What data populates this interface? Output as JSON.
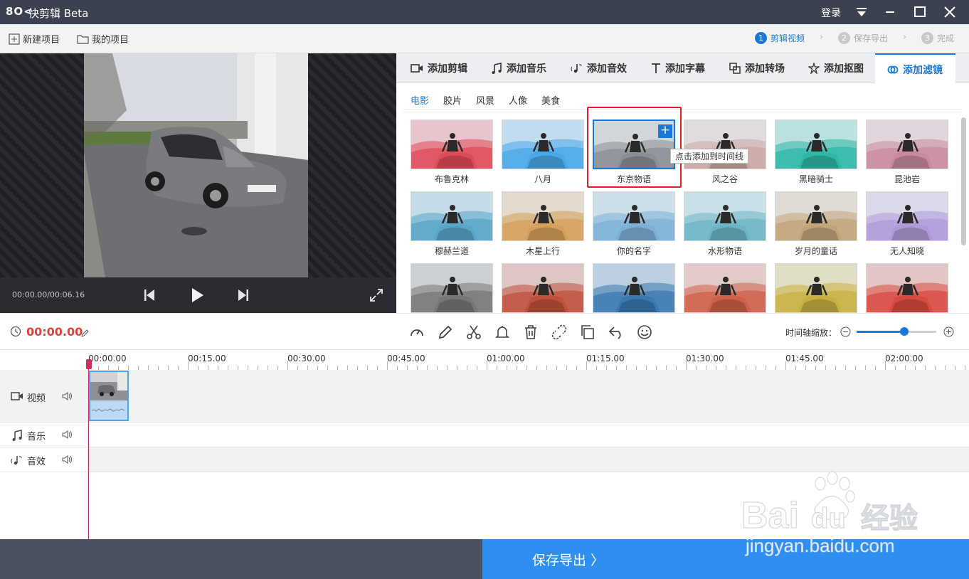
{
  "app": {
    "logo": "8O<",
    "name": "快剪辑 Beta"
  },
  "titlebar": {
    "login_label": "登录"
  },
  "toolbar": {
    "new_project": "新建项目",
    "my_projects": "我的项目",
    "steps": [
      {
        "num": "1",
        "label": "剪辑视频",
        "active": true
      },
      {
        "num": "2",
        "label": "保存导出",
        "active": false
      },
      {
        "num": "3",
        "label": "完成",
        "active": false
      }
    ]
  },
  "player": {
    "timecode": "00:00.00/00:06.16"
  },
  "tabs": [
    {
      "label": "添加剪辑",
      "icon": "video-icon"
    },
    {
      "label": "添加音乐",
      "icon": "music-icon"
    },
    {
      "label": "添加音效",
      "icon": "sound-effect-icon"
    },
    {
      "label": "添加字幕",
      "icon": "text-icon"
    },
    {
      "label": "添加转场",
      "icon": "transition-icon"
    },
    {
      "label": "添加抠图",
      "icon": "cutout-icon"
    },
    {
      "label": "添加滤镜",
      "icon": "filter-icon",
      "active": true
    }
  ],
  "categories": [
    {
      "label": "电影",
      "active": true
    },
    {
      "label": "胶片"
    },
    {
      "label": "风景"
    },
    {
      "label": "人像"
    },
    {
      "label": "美食"
    }
  ],
  "filters": [
    {
      "label": "布鲁克林",
      "tint": "#e04b5a"
    },
    {
      "label": "八月",
      "tint": "#4aa8e8"
    },
    {
      "label": "东京物语",
      "tint": "#8a8f95",
      "selected": true
    },
    {
      "label": "风之谷",
      "tint": "#c9a7a3"
    },
    {
      "label": "黑暗骑士",
      "tint": "#2fb8a8"
    },
    {
      "label": "昆池岩",
      "tint": "#c98aa0"
    },
    {
      "label": "穆赫兰道",
      "tint": "#58a6c8"
    },
    {
      "label": "木星上行",
      "tint": "#d4a05a"
    },
    {
      "label": "你的名字",
      "tint": "#7db0d6"
    },
    {
      "label": "水形物语",
      "tint": "#6cb5c7"
    },
    {
      "label": "岁月的童话",
      "tint": "#c2a47a"
    },
    {
      "label": "无人知晓",
      "tint": "#b09ad8"
    },
    {
      "label": "",
      "tint": "#777"
    },
    {
      "label": "",
      "tint": "#c0503c"
    },
    {
      "label": "",
      "tint": "#3a78b0"
    },
    {
      "label": "",
      "tint": "#d0604a"
    },
    {
      "label": "",
      "tint": "#c8b040"
    },
    {
      "label": "",
      "tint": "#d84a40"
    }
  ],
  "tooltip": {
    "text": "点击添加到时间线"
  },
  "timeline": {
    "current_time": "00:00.00",
    "zoom_label": "时间轴缩放：",
    "zoom_level": 0.56,
    "ticks": [
      "00:00.00",
      "00:15.00",
      "00:30.00",
      "00:45.00",
      "01:00.00",
      "01:15.00",
      "01:30.00",
      "01:45.00",
      "02:00.00"
    ],
    "tracks": [
      {
        "name": "视频"
      },
      {
        "name": "音乐"
      },
      {
        "name": "音效"
      }
    ]
  },
  "export": {
    "label": "保存导出 〉"
  },
  "watermark": {
    "line1": "Bai",
    "line1b": "du",
    "line1c": "经验",
    "line2": "jingyan.baidu.com"
  },
  "colors": {
    "accent": "#1a78d6",
    "titlebar": "#3c4150",
    "current_time": "#e0423a",
    "selection_box": "#e02020"
  }
}
